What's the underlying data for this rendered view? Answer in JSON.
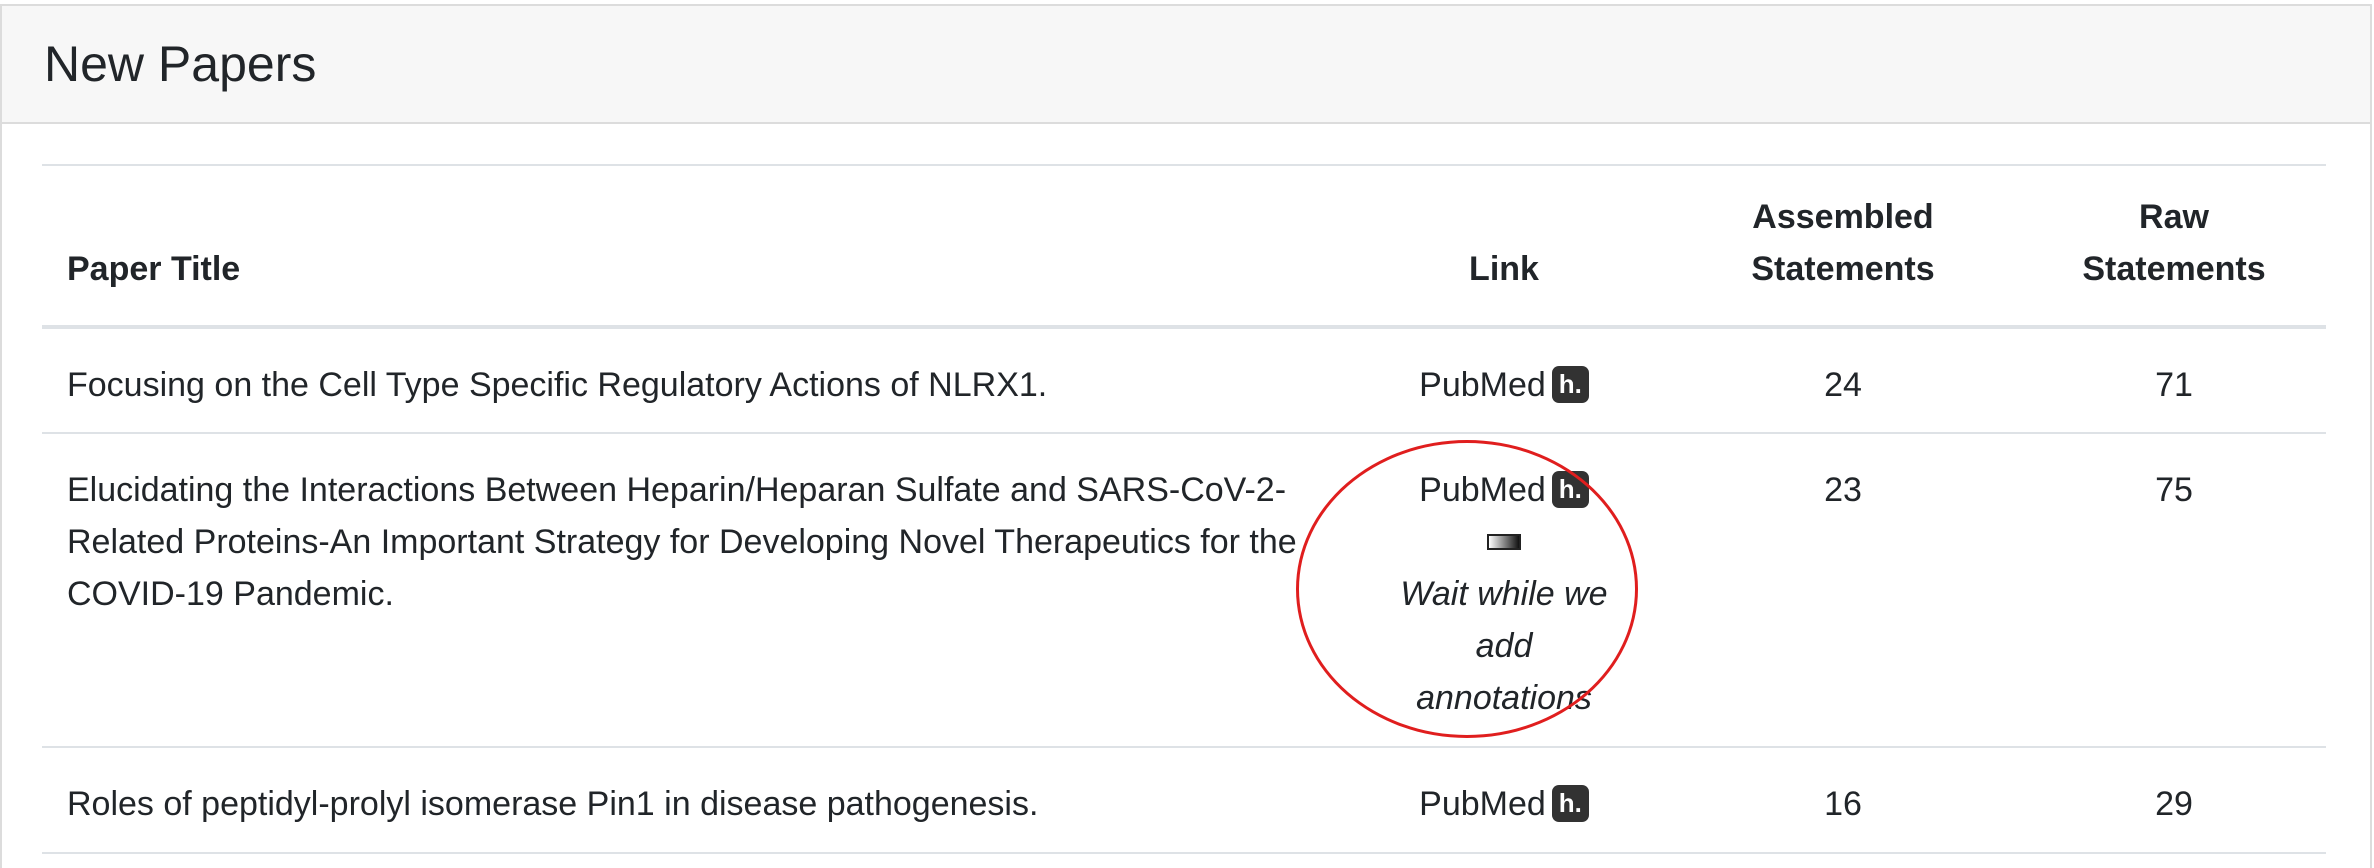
{
  "card": {
    "title": "New Papers"
  },
  "table": {
    "headers": {
      "title": "Paper Title",
      "link": "Link",
      "assembled_line1": "Assembled",
      "assembled_line2": "Statements",
      "raw": "Raw Statements"
    },
    "rows": [
      {
        "title": "Focusing on the Cell Type Specific Regulatory Actions of NLRX1.",
        "link_label": "PubMed",
        "badge_label": "h.",
        "assembled": "24",
        "raw": "71"
      },
      {
        "title": "Elucidating the Interactions Between Heparin/Heparan Sulfate and SARS-CoV-2-Related Proteins-An Important Strategy for Developing Novel Therapeutics for the COVID-19 Pandemic.",
        "link_label": "PubMed",
        "badge_label": "h.",
        "loading_icon": "progress-bar-icon",
        "loading_text": "Wait while we add annotations",
        "assembled": "23",
        "raw": "75"
      },
      {
        "title": "Roles of peptidyl-prolyl isomerase Pin1 in disease pathogenesis.",
        "link_label": "PubMed",
        "badge_label": "h.",
        "assembled": "16",
        "raw": "29"
      }
    ]
  },
  "colors": {
    "highlight_circle": "#e01e1e",
    "badge_background": "#323232",
    "header_background": "#f7f7f7"
  }
}
